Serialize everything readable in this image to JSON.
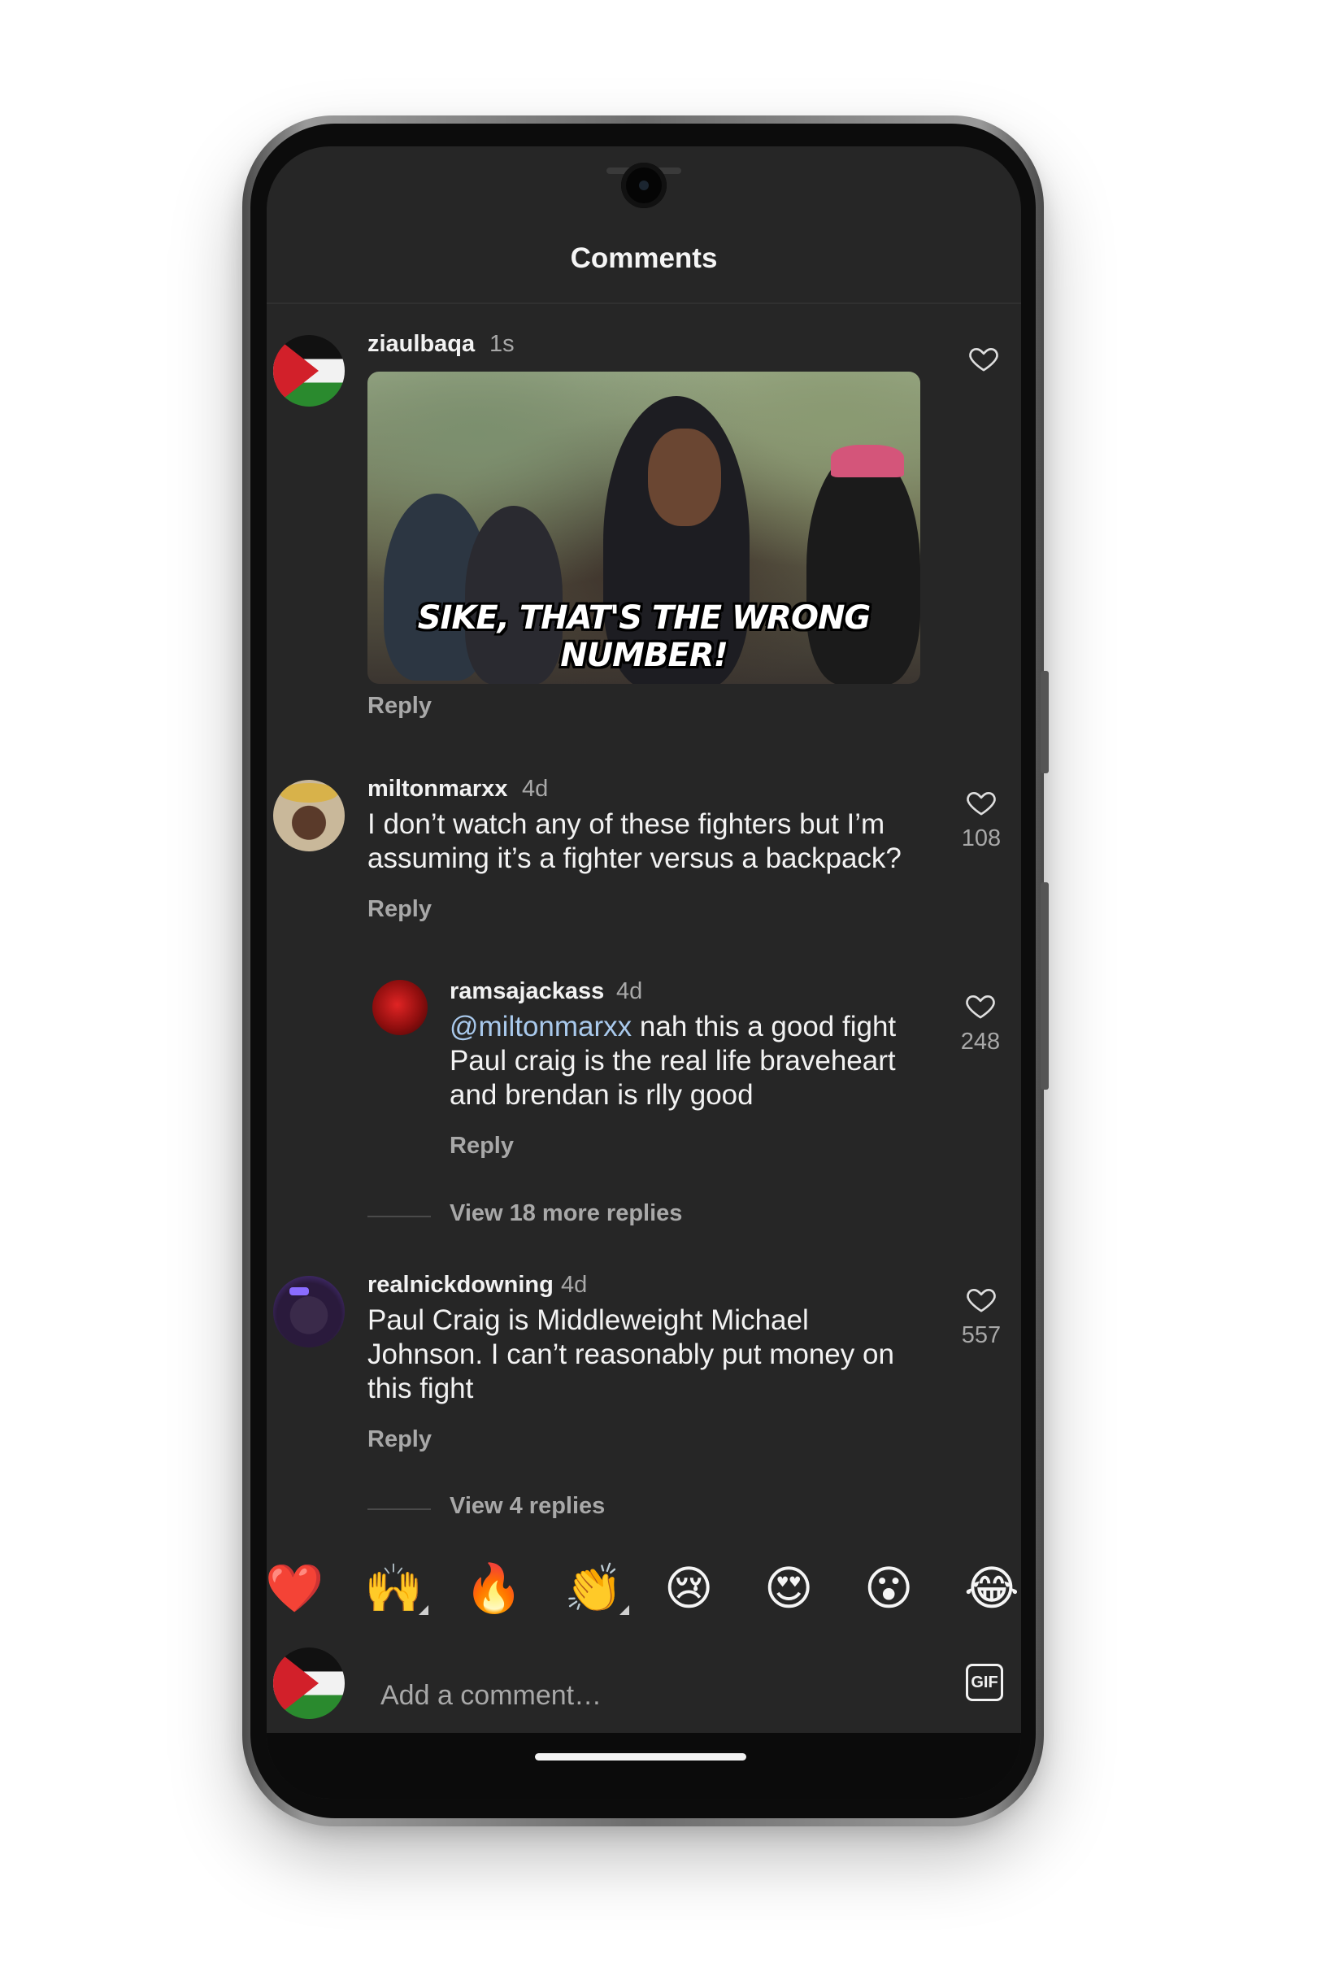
{
  "header": {
    "title": "Comments"
  },
  "comments": [
    {
      "username": "ziaulbaqa",
      "time": "1s",
      "gif_caption": "SIKE, THAT'S THE WRONG NUMBER!",
      "reply_label": "Reply"
    },
    {
      "username": "miltonmarxx",
      "time": "4d",
      "text_line1": "I don’t watch any of these fighters but I’m",
      "text_line2": "assuming it’s a fighter versus a backpack?",
      "likes": "108",
      "reply_label": "Reply",
      "reply": {
        "username": "ramsajackass",
        "time": "4d",
        "mention": "@miltonmarxx",
        "text_line1_rest": " nah this a good fight",
        "text_line2": "Paul craig is the real life braveheart",
        "text_line3": "and brendan is rlly good",
        "likes": "248",
        "reply_label": "Reply"
      },
      "view_more": "View 18 more replies"
    },
    {
      "username": "realnickdowning",
      "time": "4d",
      "text_line1": "Paul Craig is Middleweight Michael",
      "text_line2": "Johnson. I can’t reasonably put money on",
      "text_line3": "this fight",
      "likes": "557",
      "reply_label": "Reply",
      "view_more": "View 4 replies"
    }
  ],
  "emoji_bar": [
    "❤️",
    "🙌",
    "🔥",
    "👏",
    "😢",
    "😍",
    "😮",
    "😂"
  ],
  "composer": {
    "placeholder": "Add a comment…",
    "gif_label": "GIF"
  },
  "colors": {
    "background": "#262626",
    "text": "#f2f2f2",
    "muted": "#a8a8a8",
    "mention": "#a9c9ec"
  }
}
